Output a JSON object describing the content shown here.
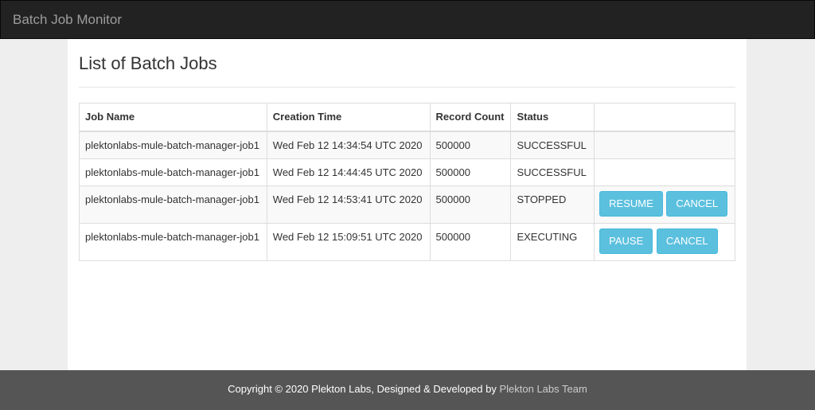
{
  "navbar": {
    "brand": "Batch Job Monitor"
  },
  "page": {
    "title": "List of Batch Jobs"
  },
  "table": {
    "headers": [
      "Job Name",
      "Creation Time",
      "Record Count",
      "Status"
    ],
    "rows": [
      {
        "job_name": "plektonlabs-mule-batch-manager-job1",
        "creation_time": "Wed Feb 12 14:34:54 UTC 2020",
        "record_count": "500000",
        "status": "SUCCESSFUL"
      },
      {
        "job_name": "plektonlabs-mule-batch-manager-job1",
        "creation_time": "Wed Feb 12 14:44:45 UTC 2020",
        "record_count": "500000",
        "status": "SUCCESSFUL"
      },
      {
        "job_name": "plektonlabs-mule-batch-manager-job1",
        "creation_time": "Wed Feb 12 14:53:41 UTC 2020",
        "record_count": "500000",
        "status": "STOPPED",
        "actions": [
          "RESUME",
          "CANCEL"
        ]
      },
      {
        "job_name": "plektonlabs-mule-batch-manager-job1",
        "creation_time": "Wed Feb 12 15:09:51 UTC 2020",
        "record_count": "500000",
        "status": "EXECUTING",
        "actions": [
          "PAUSE",
          "CANCEL"
        ]
      }
    ]
  },
  "footer": {
    "text": "Copyright © 2020 Plekton Labs, Designed & Developed by",
    "team_link": "Plekton Labs Team"
  },
  "colors": {
    "navbar": "#222222",
    "button": "#5bc0de",
    "footer": "#555555"
  }
}
